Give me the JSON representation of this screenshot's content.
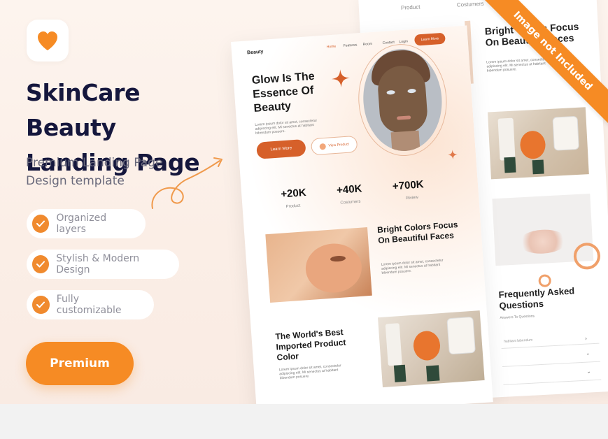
{
  "colors": {
    "accent": "#f68b24",
    "mockup_accent": "#d6602a",
    "title": "#15173d"
  },
  "hero": {
    "icon": "heart-icon",
    "title_line1": "SkinCare Beauty",
    "title_line2": "Landing Page",
    "subtitle_line1": "Premium Landing Page",
    "subtitle_line2": "Design template"
  },
  "features": [
    {
      "label": "Organized layers",
      "icon": "check-icon"
    },
    {
      "label": "Stylish & Modern Design",
      "icon": "check-icon"
    },
    {
      "label": "Fully customizable",
      "icon": "check-icon"
    }
  ],
  "premium_label": "Premium",
  "ribbon_label": "Image not Included",
  "front_mockup": {
    "logo": "Beauty",
    "nav": [
      "Home",
      "Features",
      "Room",
      "Contact",
      "Login"
    ],
    "cta": "Learn More",
    "hero_title": "Glow Is The Essence Of Beauty",
    "hero_text": "Lorem ipsum dolor sit amet, consectetur adipiscing elit. Mi senectus at habitant bibendum posuere.",
    "btn_primary": "Learn More",
    "btn_secondary": "View Product",
    "stats": [
      {
        "value": "+20K",
        "label": "Product"
      },
      {
        "value": "+40K",
        "label": "Costumers"
      },
      {
        "value": "+700K",
        "label": "Riview"
      }
    ],
    "section1_title": "Bright Colors Focus On Beautiful Faces",
    "section1_text": "Lorem ipsum dolor sit amet, consectetur adipiscing elit. Mi senectus at habitant bibendum posuere.",
    "section2_title": "The World's Best Imported Product Color",
    "section2_text": "Lorem ipsum dolor sit amet, consectetur adipiscing elit. Mi senectus at habitant bibendum posuere."
  },
  "back_mockup": {
    "nav": [
      "Product",
      "Costumers"
    ],
    "heading": "Bright Colors Focus On Beautiful Faces",
    "text": "Lorem ipsum dolor sit amet, consectetur adipiscing elit. Mi senectus at habitant bibendum posuere.",
    "faq_title": "Frequently Asked Questions",
    "faq_sub": "Answers To Questions",
    "faq_rows": [
      "habitant bibendum",
      "",
      ""
    ]
  }
}
